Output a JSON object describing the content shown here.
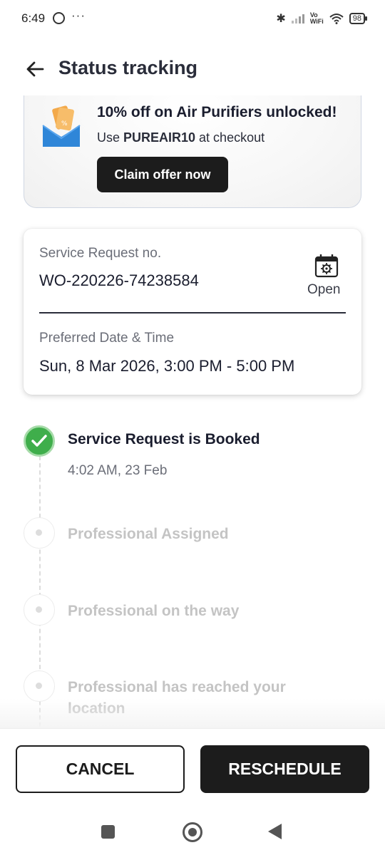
{
  "status_bar": {
    "time": "6:49",
    "dots": "···",
    "bluetooth": "✱",
    "vowifi_top": "Vo",
    "vowifi_bottom": "WiFi",
    "battery": "98"
  },
  "header": {
    "title": "Status tracking",
    "back_icon": "arrow-left-icon"
  },
  "offer": {
    "title": "10% off on Air Purifiers unlocked!",
    "subtitle_prefix": "Use ",
    "code": "PUREAIR10",
    "subtitle_suffix": " at checkout",
    "button_label": "Claim offer now",
    "icon": "coupon-envelope-icon"
  },
  "service_card": {
    "request_label": "Service Request no.",
    "request_number": "WO-220226-74238584",
    "open_label": "Open",
    "open_icon": "calendar-gear-icon",
    "date_label": "Preferred Date & Time",
    "date_value": "Sun, 8 Mar 2026, 3:00 PM - 5:00 PM"
  },
  "timeline": {
    "steps": [
      {
        "title": "Service Request is Booked",
        "time": "4:02 AM, 23 Feb",
        "status": "done"
      },
      {
        "title": "Professional Assigned",
        "status": "pending"
      },
      {
        "title": "Professional on the way",
        "status": "pending"
      },
      {
        "title": "Professional has reached your location",
        "status": "pending"
      }
    ]
  },
  "actions": {
    "cancel_label": "CANCEL",
    "reschedule_label": "RESCHEDULE"
  },
  "colors": {
    "accent_dark": "#1c1c1c",
    "success_green": "#3fae4b",
    "muted_text": "#c4c4c4"
  }
}
